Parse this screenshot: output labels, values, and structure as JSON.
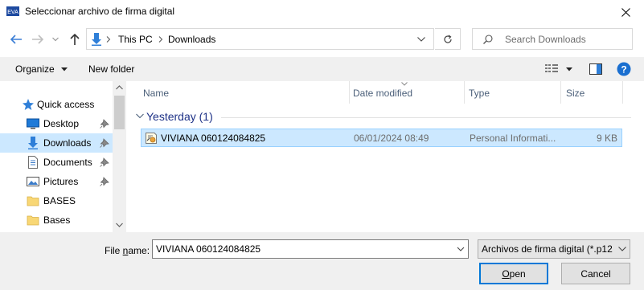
{
  "window": {
    "app_icon_text": "EVA",
    "title": "Seleccionar archivo de firma digital"
  },
  "address": {
    "crumbs": [
      "This PC",
      "Downloads"
    ],
    "search_placeholder": "Search Downloads"
  },
  "toolbar": {
    "organize_label": "Organize",
    "new_folder_label": "New folder"
  },
  "sidebar": {
    "items": [
      {
        "label": "Quick access",
        "icon": "star-icon",
        "pinned": false
      },
      {
        "label": "Desktop",
        "icon": "desktop-icon",
        "pinned": true
      },
      {
        "label": "Downloads",
        "icon": "download-icon",
        "pinned": true,
        "selected": true
      },
      {
        "label": "Documents",
        "icon": "documents-icon",
        "pinned": true
      },
      {
        "label": "Pictures",
        "icon": "pictures-icon",
        "pinned": true
      },
      {
        "label": "BASES",
        "icon": "folder-icon",
        "pinned": false
      },
      {
        "label": "Bases",
        "icon": "folder-icon",
        "pinned": false
      }
    ]
  },
  "filelist": {
    "columns": [
      "Name",
      "Date modified",
      "Type",
      "Size"
    ],
    "group_title": "Yesterday (1)",
    "rows": [
      {
        "name": "VIVIANA 060124084825",
        "date": "06/01/2024 08:49",
        "type": "Personal Informati...",
        "size": "9 KB"
      }
    ]
  },
  "footer": {
    "filename_label_pre": "File ",
    "filename_label_u": "n",
    "filename_label_post": "ame:",
    "filename_value": "VIVIANA 060124084825",
    "filetype_value": "Archivos de firma digital (*.p12",
    "open_label_u": "O",
    "open_label_rest": "pen",
    "cancel_label": "Cancel"
  },
  "colors": {
    "accent": "#0078d7",
    "selection": "#cce8ff",
    "selection_border": "#99d1ff",
    "group_title": "#1e3287",
    "header_text": "#4c607a"
  }
}
